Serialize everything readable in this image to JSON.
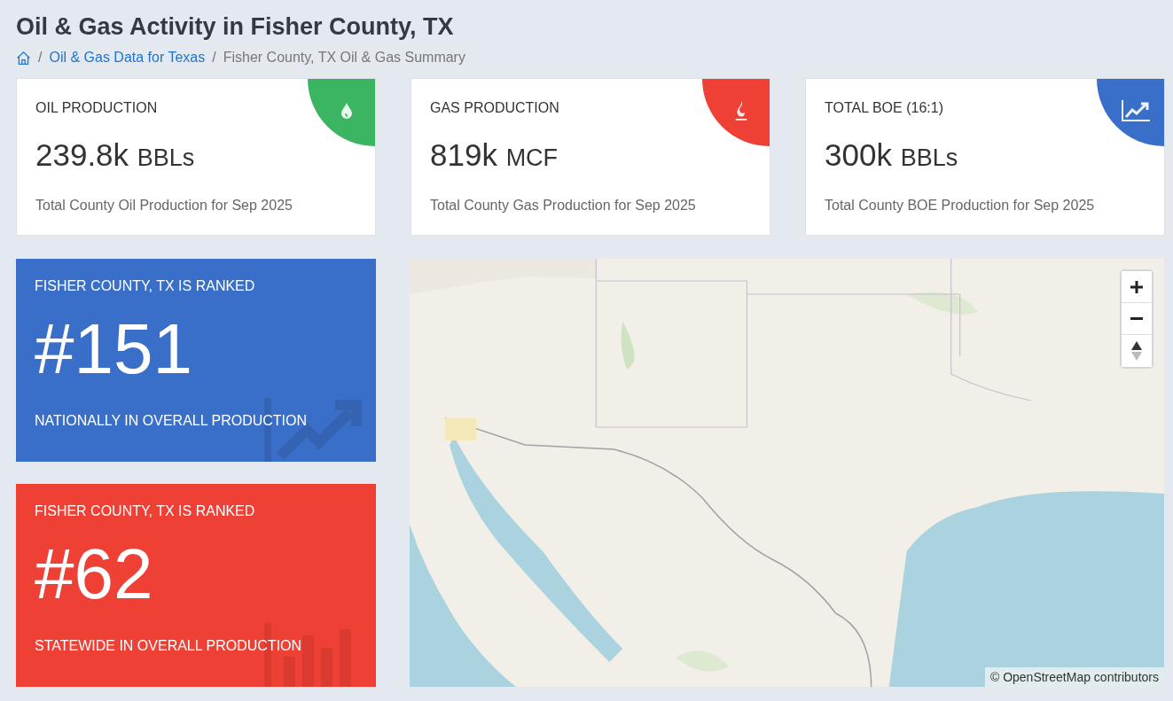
{
  "page": {
    "title": "Oil & Gas Activity in Fisher County, TX"
  },
  "breadcrumb": [
    {
      "kind": "home"
    },
    {
      "kind": "link",
      "separator": "/",
      "label": "Oil & Gas Data for Texas"
    },
    {
      "kind": "current",
      "separator": "/",
      "label": "Fisher County, TX Oil & Gas Summary"
    }
  ],
  "stat_cards": [
    {
      "kind": "oil",
      "label": "OIL PRODUCTION",
      "value": "239.8k",
      "unit": "BBLs",
      "caption": "Total County Oil Production for Sep 2025"
    },
    {
      "kind": "gas",
      "label": "GAS PRODUCTION",
      "value": "819k",
      "unit": "MCF",
      "caption": "Total County Gas Production for Sep 2025"
    },
    {
      "kind": "boe",
      "label": "TOTAL BOE (16:1)",
      "value": "300k",
      "unit": "BBLs",
      "caption": "Total County BOE Production for Sep 2025"
    }
  ],
  "rank_cards": [
    {
      "kind": "national",
      "heading": "FISHER COUNTY, TX IS RANKED",
      "rank": "#151",
      "caption": "NATIONALLY IN OVERALL PRODUCTION"
    },
    {
      "kind": "state",
      "heading": "FISHER COUNTY, TX IS RANKED",
      "rank": "#62",
      "caption": "STATEWIDE IN OVERALL PRODUCTION"
    }
  ],
  "map": {
    "attribution": "© OpenStreetMap contributors"
  }
}
